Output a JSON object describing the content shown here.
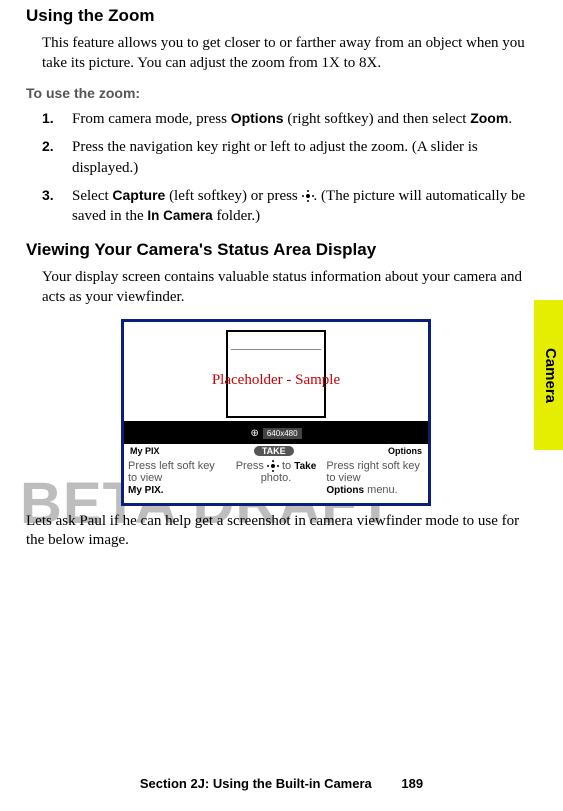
{
  "heading1": "Using the Zoom",
  "intro1": "This feature allows you to get closer to or farther away from an object when you take its picture. You can adjust the zoom from 1X to 8X.",
  "subhead1": "To use the zoom:",
  "steps": [
    {
      "num": "1.",
      "pre": "From camera mode, press ",
      "b1": "Options",
      "mid": " (right softkey) and then select ",
      "b2": "Zoom",
      "post": "."
    },
    {
      "num": "2.",
      "text": "Press the navigation key right or left to adjust the zoom. (A slider is displayed.)"
    },
    {
      "num": "3.",
      "pre": "Select ",
      "b1": "Capture",
      "mid": " (left softkey) or press ",
      "post": ". (The picture will automatically be saved in the ",
      "b2": "In Camera",
      "post2": " folder.)"
    }
  ],
  "heading2": "Viewing Your Camera's Status Area Display",
  "intro2": "Your display screen contains valuable status information about your camera and acts as your viewfinder.",
  "figure": {
    "placeholder": "Placeholder - Sample",
    "resolution": "640x480",
    "soft_left": "My PIX",
    "soft_center": "TAKE",
    "soft_right": "Options",
    "hint_left_1": "Press left soft key to view",
    "hint_left_2": "My PIX.",
    "hint_center_1": "Press",
    "hint_center_2": "to",
    "hint_center_3": "Take",
    "hint_center_4": "photo.",
    "hint_right_1": "Press right soft key to view",
    "hint_right_2": "Options",
    "hint_right_3": "menu."
  },
  "note": "Lets ask Paul if he can help get a screenshot in camera viewfinder mode to use for the below image.",
  "watermark": "BETA DRAFT",
  "sidetab": "Camera",
  "footer_section": "Section 2J: Using the Built-in Camera",
  "footer_page": "189"
}
